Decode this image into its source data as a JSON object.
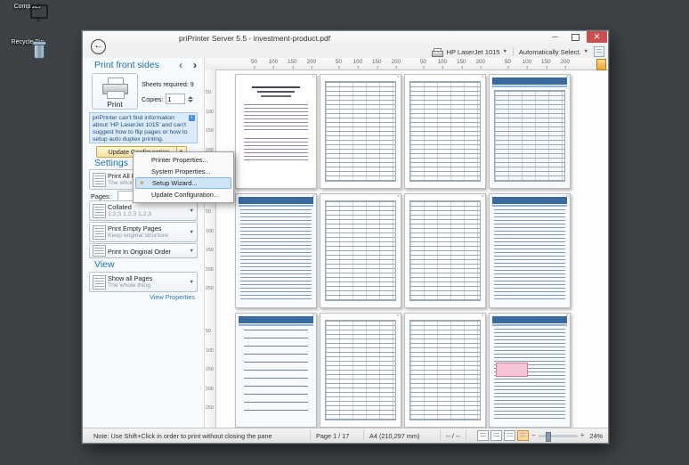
{
  "desktop": {
    "icons": [
      {
        "label": "Computer"
      },
      {
        "label": "Recycle Bin"
      }
    ]
  },
  "window": {
    "title": "priPrinter Server 5.5 - investment-product.pdf",
    "printer": "HP LaserJet 1015",
    "paper": "Automatically Select."
  },
  "panel": {
    "mode_heading": "Print front sides",
    "print_label": "Print",
    "sheets": "Sheets required: 9",
    "copies_label": "Copies:",
    "copies_value": "1",
    "warning": "priPrinter can't find information about 'HP LaserJet 1015' and can't suggest how to flip pages or how to setup auto duplex printing.",
    "update_button": "Update Configuration...",
    "settings_heading": "Settings",
    "print_range": {
      "label": "Print All Pages",
      "sub": "The whole thing"
    },
    "pages_label": "Pages:",
    "pages_value": "",
    "collate": {
      "label": "Collated",
      "sub": "1,2,3  1,2,3  1,2,3"
    },
    "empty": {
      "label": "Print Empty Pages",
      "sub": "Keep original structure"
    },
    "order": {
      "label": "Print In Original Order"
    },
    "view_heading": "View",
    "show": {
      "label": "Show all Pages",
      "sub": "The whole thing"
    },
    "view_properties": "View Properties"
  },
  "menu": {
    "items": [
      {
        "label": "Printer Properties...",
        "highlight": false
      },
      {
        "label": "System Properties...",
        "highlight": false
      },
      {
        "label": "Setup Wizard...",
        "highlight": true
      },
      {
        "label": "Update Configuration...",
        "highlight": false
      }
    ]
  },
  "ruler": {
    "h_marks": [
      50,
      100,
      150,
      200
    ],
    "v_marks": [
      50,
      100,
      150,
      200,
      250
    ]
  },
  "preview": {
    "pages": [
      {
        "style": "title"
      },
      {
        "style": "table"
      },
      {
        "style": "table"
      },
      {
        "style": "blue-table"
      },
      {
        "style": "blue-text"
      },
      {
        "style": "table"
      },
      {
        "style": "table"
      },
      {
        "style": "blue-text"
      },
      {
        "style": "blue-sparse"
      },
      {
        "style": "table"
      },
      {
        "style": "table"
      },
      {
        "style": "blue-text",
        "highlight": true
      }
    ]
  },
  "statusbar": {
    "note": "Note: Use Shift+Click in order to print without closing the pane",
    "page": "Page 1 / 17",
    "paper": "A4 (210,297 mm)",
    "pos": "-- / --",
    "zoom": "24%"
  }
}
